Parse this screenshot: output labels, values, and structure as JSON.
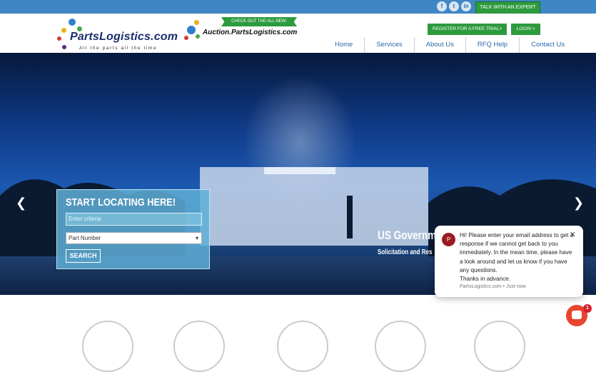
{
  "topbar": {
    "social": [
      "f",
      "t",
      "in"
    ],
    "talk_button": "TALK WITH AN EXPERT"
  },
  "header": {
    "logo_main": "PartsLogistics.com",
    "logo_tagline": "All the parts all the time",
    "auction_banner": "CHECK OUT THE ALL NEW:",
    "auction_text": "Auction.PartsLogistics.com",
    "register_button": "REGISTER FOR A FREE TRIAL>",
    "login_button": "LOGIN >",
    "nav": [
      "Home",
      "Services",
      "About Us",
      "RFQ Help",
      "Contact Us"
    ]
  },
  "hero": {
    "prev_arrow": "❮",
    "next_arrow": "❯",
    "slide_title": "US Governme",
    "slide_subtitle": "Solicitation and Res"
  },
  "locate": {
    "title": "START LOCATING HERE!",
    "placeholder": "Enter criteria",
    "select_value": "Part Number",
    "search_button": "SEARCH"
  },
  "chat": {
    "avatar_letter": "P",
    "message": "Hi! Please enter your email address to get a response if we cannot get back to you immediately.  In the mean time, please have a look around and let us know if you have any questions.\n Thanks in advance.",
    "meta": "PartsLogistics.com • Just now",
    "badge_count": "1"
  },
  "colors": {
    "topbar": "#3f86c4",
    "green": "#2e9a3e",
    "nav_link": "#2b6aa5"
  }
}
